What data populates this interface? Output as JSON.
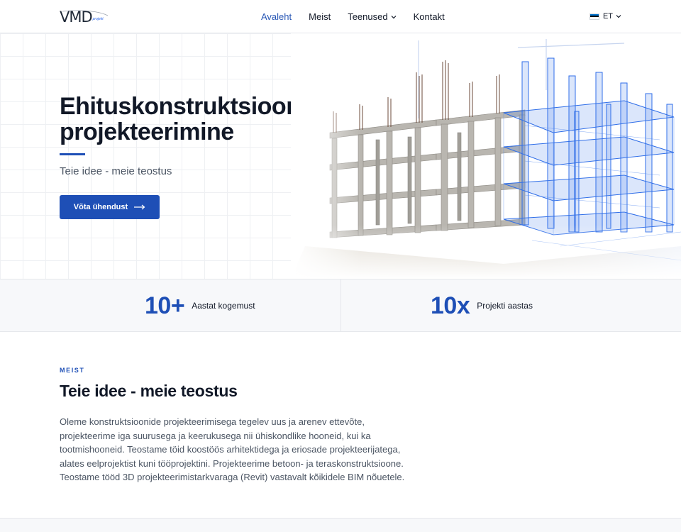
{
  "header": {
    "logo": {
      "text": "VMD",
      "sub": "projekt"
    },
    "nav": [
      {
        "label": "Avaleht",
        "active": true
      },
      {
        "label": "Meist"
      },
      {
        "label": "Teenused",
        "has_dropdown": true
      },
      {
        "label": "Kontakt"
      }
    ],
    "language": {
      "code": "ET",
      "flag_colors": [
        "#0072ce",
        "#000000",
        "#ffffff"
      ]
    }
  },
  "hero": {
    "title": "Ehituskonstruktsioonide projekteerimine",
    "subtitle": "Teie idee - meie teostus",
    "cta_label": "Võta ühendust",
    "image_icon": "building-construction-wireframe"
  },
  "stats": [
    {
      "value": "10+",
      "label": "Aastat kogemust"
    },
    {
      "value": "10x",
      "label": "Projekti aastas"
    }
  ],
  "about": {
    "kicker": "MEIST",
    "title": "Teie idee - meie teostus",
    "lines": [
      "Oleme konstruktsioonide projekteerimisega tegelev uus ja arenev ettevõte,",
      "projekteerime iga suurusega ja keerukusega nii ühiskondlike hooneid, kui ka",
      "tootmishooneid. Teostame töid koostöös arhitektidega ja eriosade projekteerijatega,",
      "alates eelprojektist kuni tööprojektini. Projekteerime betoon- ja teraskonstruktsioone.",
      "Teostame tööd 3D projekteerimistarkvaraga (Revit) vastavalt kõikidele BIM nõuetele."
    ]
  },
  "colors": {
    "accent": "#1e4fb6",
    "nav_active": "#2857b5",
    "text": "#111827",
    "muted": "#4b5563"
  }
}
